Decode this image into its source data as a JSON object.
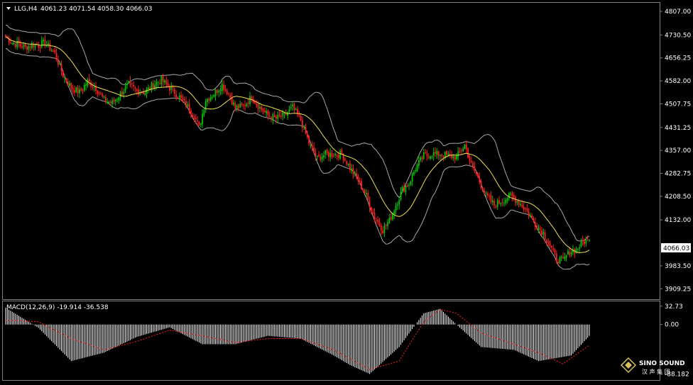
{
  "header": {
    "symbol": "LLG,H4",
    "ohlc": "4061.23 4071.54 4058.30 4066.03",
    "macd_label": "MACD(12,26,9) -19.914 -36.538"
  },
  "price_axis": {
    "ticks": [
      "4807.00",
      "4730.50",
      "4656.25",
      "4582.00",
      "4507.75",
      "4431.25",
      "4357.00",
      "4282.75",
      "4208.50",
      "4132.00",
      "4066.03",
      "3983.50",
      "3909.25"
    ],
    "current_price": "4066.03"
  },
  "macd_axis": {
    "ticks": [
      "32.73",
      "0.00",
      "-88.182"
    ]
  },
  "logo": {
    "name": "SINO SOUND",
    "subtext": "汉 声 集 团"
  },
  "colors": {
    "background": "#000000",
    "up": "#00c800",
    "down": "#ff1e1e",
    "ma": "#f0e050",
    "bands": "#a8a8a8",
    "grid": "#808080",
    "text": "#ffffff",
    "macd_hist": "#ffffff",
    "macd_signal": "#ff2020"
  },
  "chart_data": [
    {
      "type": "candlestick",
      "title": "",
      "symbol": "LLG",
      "timeframe": "H4",
      "ylim": [
        3880,
        4830
      ],
      "last_close": 4066.03,
      "indicators": [
        "Bollinger Bands",
        "Moving Average"
      ],
      "close_path": [
        [
          0,
          4725
        ],
        [
          4,
          4705
        ],
        [
          8,
          4700
        ],
        [
          12,
          4690
        ],
        [
          16,
          4700
        ],
        [
          20,
          4698
        ],
        [
          24,
          4705
        ],
        [
          30,
          4670
        ],
        [
          35,
          4600
        ],
        [
          40,
          4560
        ],
        [
          45,
          4545
        ],
        [
          50,
          4580
        ],
        [
          55,
          4560
        ],
        [
          60,
          4520
        ],
        [
          65,
          4510
        ],
        [
          70,
          4540
        ],
        [
          75,
          4570
        ],
        [
          80,
          4550
        ],
        [
          85,
          4545
        ],
        [
          90,
          4570
        ],
        [
          95,
          4585
        ],
        [
          100,
          4560
        ],
        [
          105,
          4535
        ],
        [
          110,
          4505
        ],
        [
          115,
          4470
        ],
        [
          118,
          4430
        ],
        [
          122,
          4520
        ],
        [
          127,
          4540
        ],
        [
          132,
          4570
        ],
        [
          136,
          4540
        ],
        [
          140,
          4495
        ],
        [
          145,
          4500
        ],
        [
          150,
          4530
        ],
        [
          155,
          4495
        ],
        [
          160,
          4470
        ],
        [
          165,
          4460
        ],
        [
          170,
          4470
        ],
        [
          175,
          4495
        ],
        [
          180,
          4455
        ],
        [
          185,
          4380
        ],
        [
          190,
          4330
        ],
        [
          195,
          4345
        ],
        [
          200,
          4345
        ],
        [
          205,
          4345
        ],
        [
          210,
          4300
        ],
        [
          215,
          4260
        ],
        [
          220,
          4210
        ],
        [
          225,
          4140
        ],
        [
          230,
          4100
        ],
        [
          234,
          4130
        ],
        [
          238,
          4180
        ],
        [
          242,
          4230
        ],
        [
          246,
          4250
        ],
        [
          250,
          4300
        ],
        [
          255,
          4340
        ],
        [
          260,
          4345
        ],
        [
          265,
          4345
        ],
        [
          270,
          4340
        ],
        [
          275,
          4335
        ],
        [
          280,
          4375
        ],
        [
          284,
          4310
        ],
        [
          288,
          4270
        ],
        [
          293,
          4210
        ],
        [
          298,
          4180
        ],
        [
          303,
          4195
        ],
        [
          308,
          4210
        ],
        [
          313,
          4190
        ],
        [
          318,
          4160
        ],
        [
          323,
          4120
        ],
        [
          328,
          4090
        ],
        [
          332,
          4050
        ],
        [
          336,
          4005
        ],
        [
          340,
          4000
        ],
        [
          344,
          4030
        ],
        [
          348,
          4035
        ],
        [
          352,
          4060
        ],
        [
          356,
          4066
        ]
      ]
    },
    {
      "type": "bar",
      "title": "",
      "indicator": "MACD",
      "params": [
        12,
        26,
        9
      ],
      "values": {
        "macd": -19.914,
        "signal": -36.538
      },
      "ylim": [
        -95,
        35
      ],
      "hist_path": [
        [
          0,
          30
        ],
        [
          20,
          -6
        ],
        [
          40,
          -65
        ],
        [
          60,
          -50
        ],
        [
          80,
          -22
        ],
        [
          100,
          -5
        ],
        [
          120,
          -35
        ],
        [
          140,
          -35
        ],
        [
          160,
          -20
        ],
        [
          180,
          -25
        ],
        [
          200,
          -55
        ],
        [
          210,
          -72
        ],
        [
          222,
          -88
        ],
        [
          240,
          -40
        ],
        [
          255,
          20
        ],
        [
          265,
          28
        ],
        [
          275,
          0
        ],
        [
          290,
          -40
        ],
        [
          310,
          -45
        ],
        [
          325,
          -65
        ],
        [
          345,
          -55
        ],
        [
          356,
          -20
        ]
      ],
      "signal_path": [
        [
          0,
          8
        ],
        [
          20,
          5
        ],
        [
          40,
          -25
        ],
        [
          60,
          -45
        ],
        [
          80,
          -30
        ],
        [
          100,
          -10
        ],
        [
          120,
          -20
        ],
        [
          140,
          -32
        ],
        [
          160,
          -25
        ],
        [
          180,
          -25
        ],
        [
          200,
          -45
        ],
        [
          222,
          -80
        ],
        [
          240,
          -65
        ],
        [
          255,
          5
        ],
        [
          265,
          27
        ],
        [
          275,
          20
        ],
        [
          290,
          -15
        ],
        [
          310,
          -35
        ],
        [
          325,
          -50
        ],
        [
          340,
          -70
        ],
        [
          356,
          -36.5
        ]
      ]
    }
  ]
}
